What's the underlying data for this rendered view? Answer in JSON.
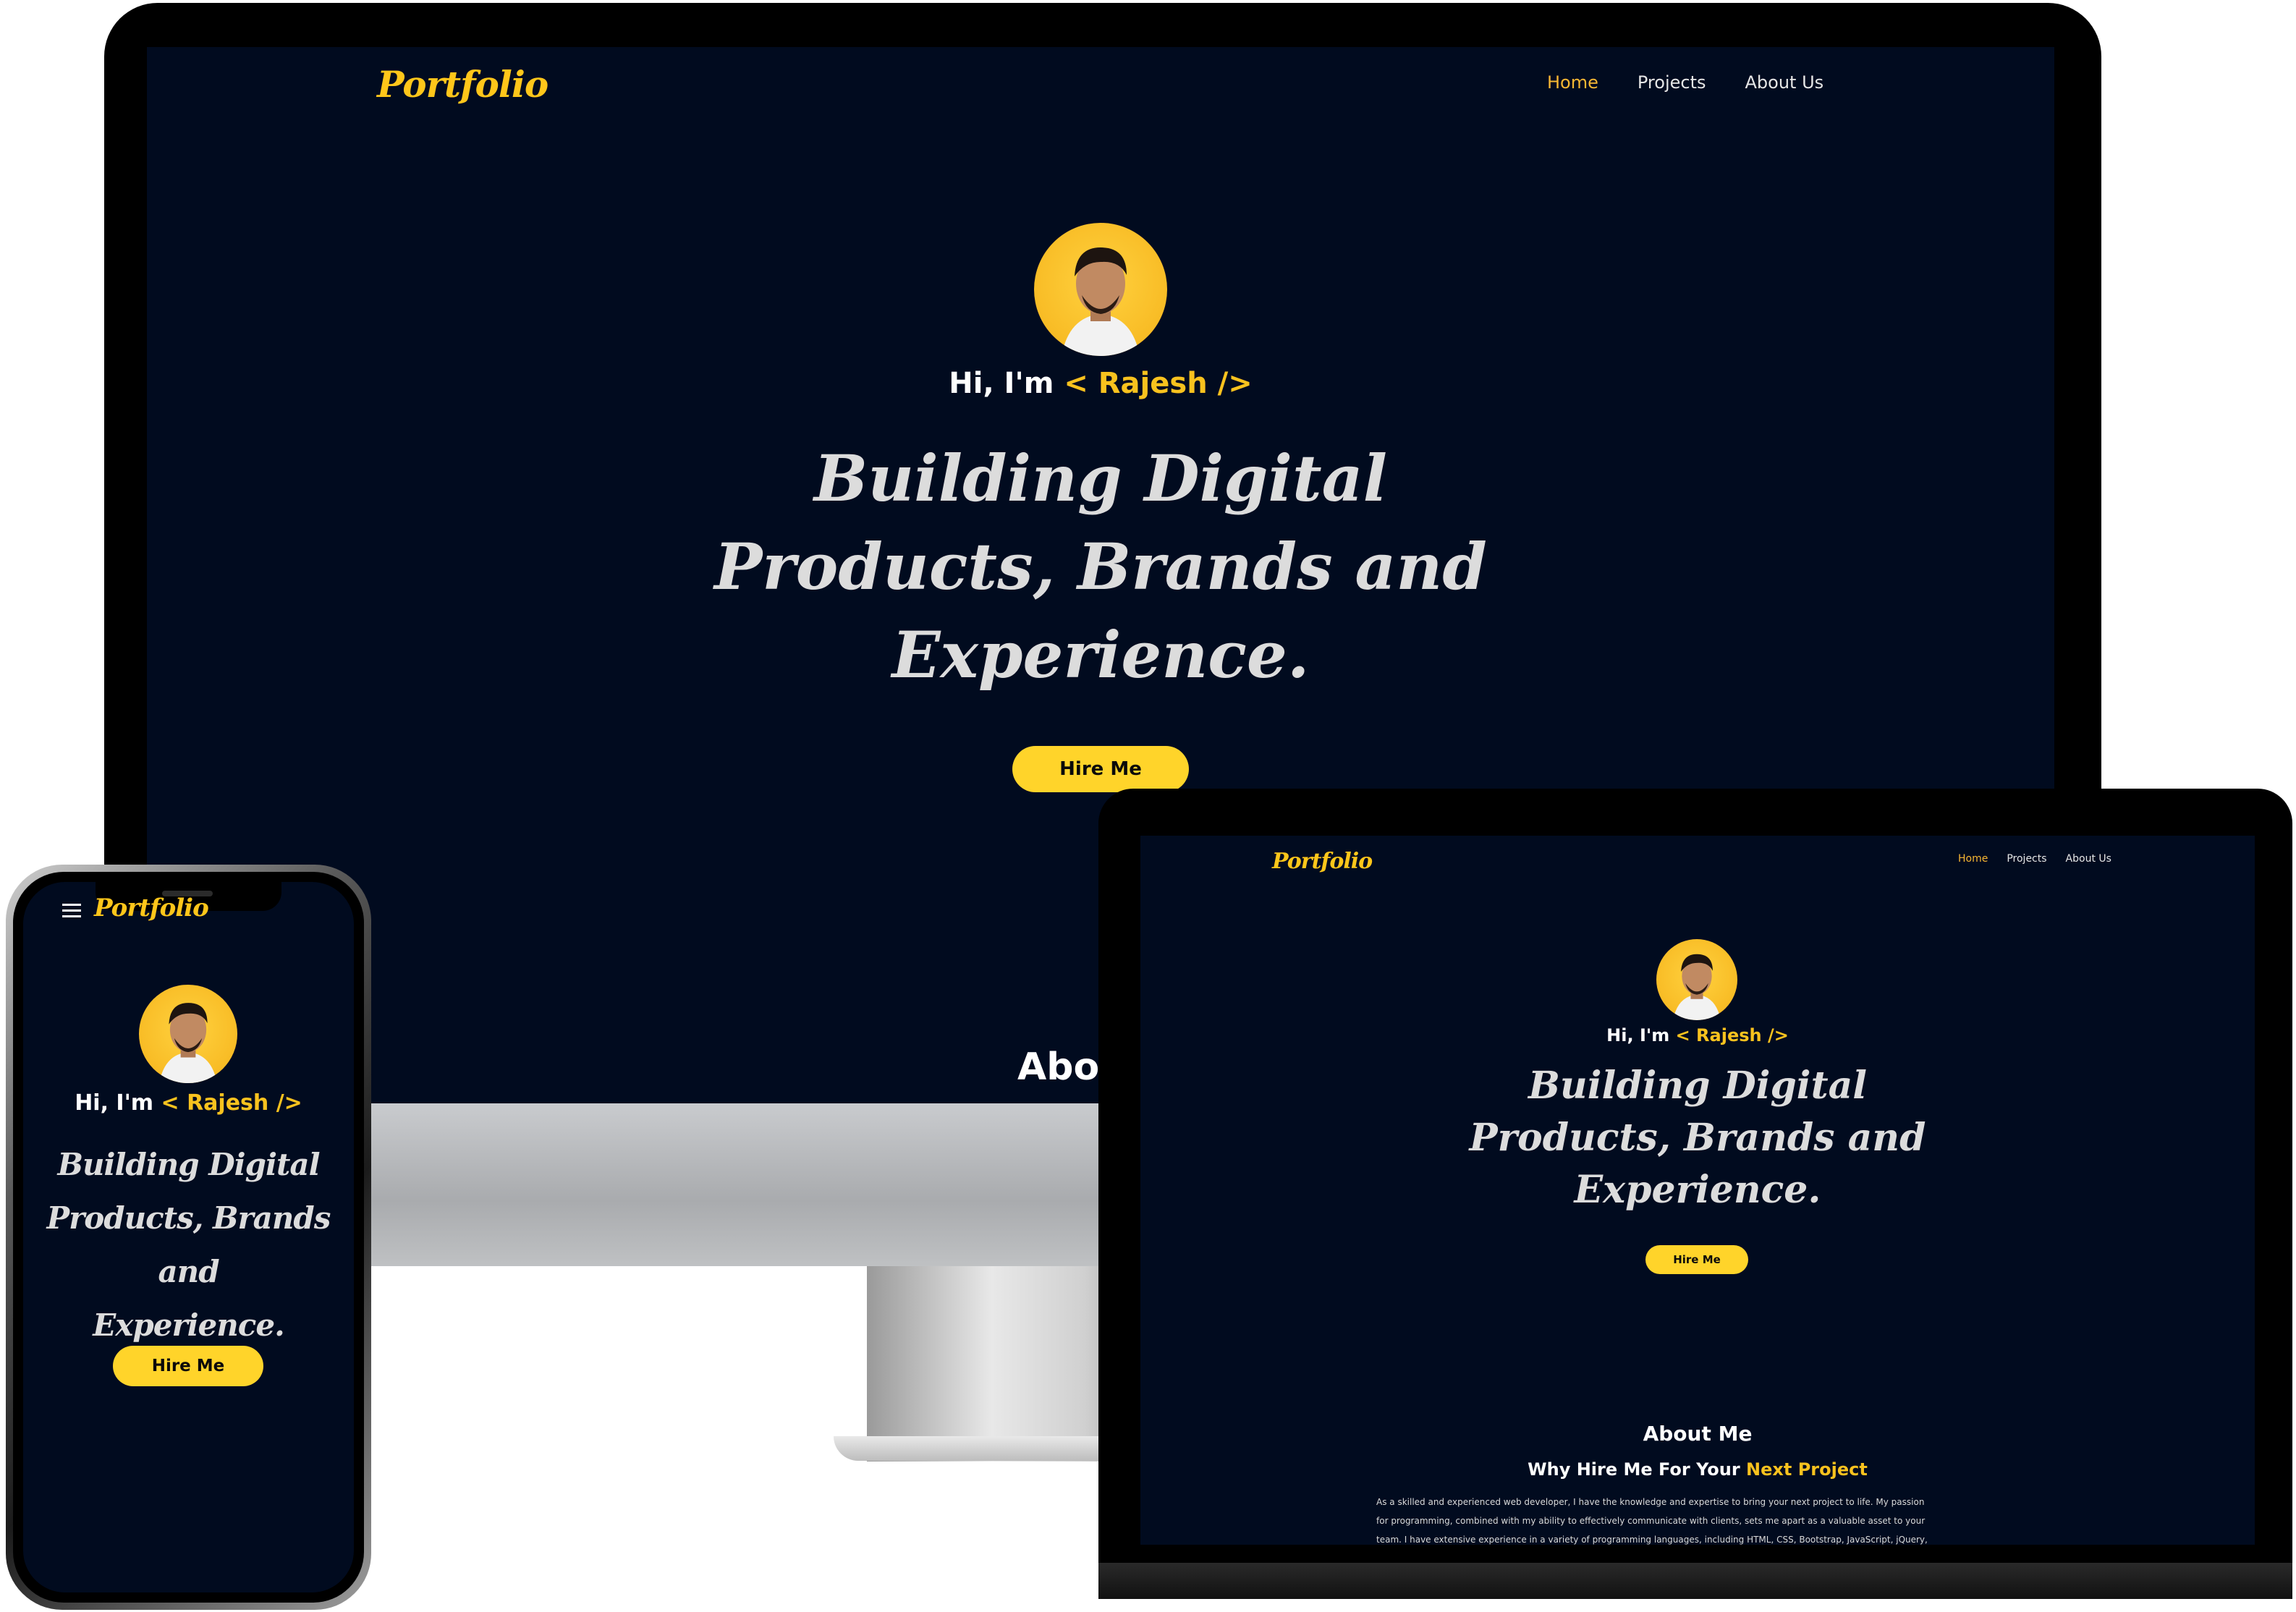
{
  "site": {
    "logo": "Portfolio",
    "nav": {
      "home": "Home",
      "projects": "Projects",
      "about": "About Us"
    },
    "greeting_prefix": "Hi, I'm",
    "greeting_name": "< Rajesh />",
    "headline_line1": "Building Digital",
    "headline_line2": "Products, Brands and",
    "headline_line3": "Experience.",
    "hire_button": "Hire Me",
    "about_peek": "Abou",
    "about_title": "About Me",
    "about_subtitle_prefix": "Why Hire Me For Your",
    "about_subtitle_highlight": "Next Project",
    "about_line1": "As a skilled and experienced web developer, I have the knowledge and expertise to bring your next project to life. My passion",
    "about_line2": "for programming, combined with my ability to effectively communicate with clients, sets me apart as a valuable asset to your",
    "about_line3": "team. I have extensive experience in a variety of programming languages, including HTML, CSS, Bootstrap, JavaScript, jQuery,"
  },
  "colors": {
    "background": "#010b1f",
    "accent": "#ffc61a",
    "button": "#ffd42a"
  },
  "icons": {
    "menu": "hamburger-menu-icon"
  }
}
